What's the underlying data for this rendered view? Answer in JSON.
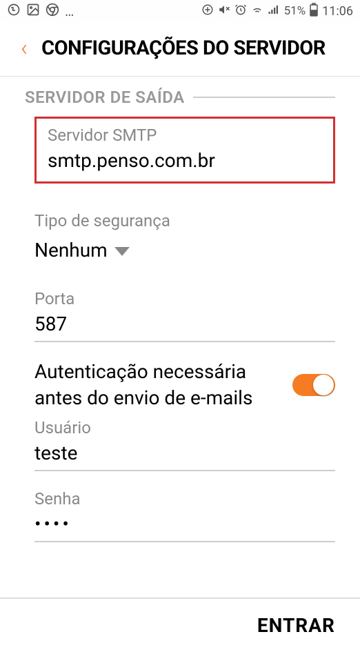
{
  "statusBar": {
    "time": "11:06",
    "battery": "51%"
  },
  "header": {
    "title": "CONFIGURAÇÕES DO SERVIDOR"
  },
  "section": {
    "title": "SERVIDOR DE SAÍDA"
  },
  "fields": {
    "smtp": {
      "label": "Servidor SMTP",
      "value": "smtp.penso.com.br"
    },
    "security": {
      "label": "Tipo de segurança",
      "value": "Nenhum"
    },
    "port": {
      "label": "Porta",
      "value": "587"
    },
    "auth": {
      "label": "Autenticação necessária antes do envio de e-mails",
      "enabled": true
    },
    "user": {
      "label": "Usuário",
      "value": "teste"
    },
    "password": {
      "label": "Senha",
      "value": "••••"
    }
  },
  "footer": {
    "enterLabel": "ENTRAR"
  }
}
